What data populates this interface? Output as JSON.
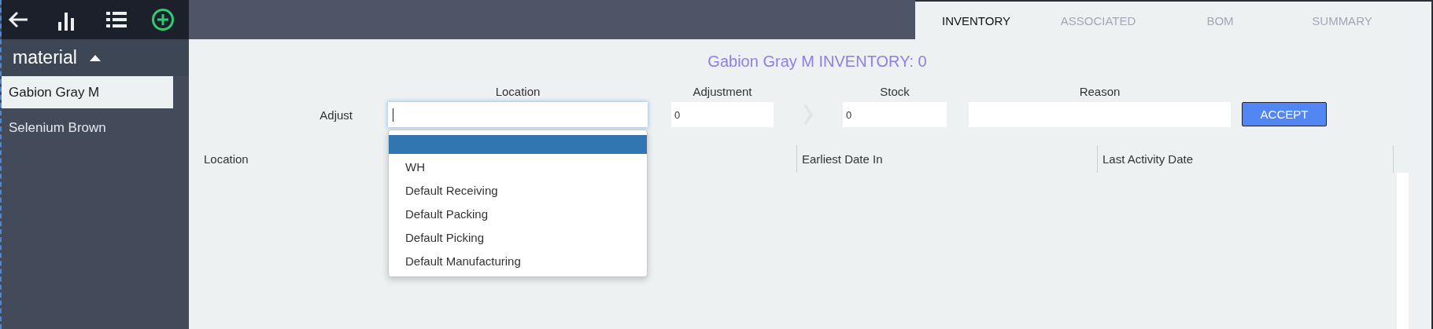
{
  "sidebar": {
    "header": "material",
    "expanded": true,
    "items": [
      {
        "label": "Gabion Gray M",
        "selected": true
      },
      {
        "label": "Selenium Brown",
        "selected": false
      }
    ]
  },
  "tabs": [
    {
      "label": "INVENTORY",
      "selected": true
    },
    {
      "label": "ASSOCIATED",
      "selected": false
    },
    {
      "label": "BOM",
      "selected": false
    },
    {
      "label": "SUMMARY",
      "selected": false
    }
  ],
  "title": "Gabion Gray M INVENTORY: 0",
  "adjust_form": {
    "label": "Adjust",
    "location": {
      "label": "Location",
      "focused": true
    },
    "adjustment": {
      "label": "Adjustment",
      "value": "0"
    },
    "stock": {
      "label": "Stock",
      "value": "0"
    },
    "reason": {
      "label": "Reason"
    },
    "button": "ACCEPT"
  },
  "location_dropdown": {
    "blank_option_selected": true,
    "options": [
      {
        "label": "WH",
        "selected": false
      },
      {
        "label": "Default Receiving",
        "selected": false
      },
      {
        "label": "Default Packing",
        "selected": false
      },
      {
        "label": "Default Picking",
        "selected": false
      },
      {
        "label": "Default Manufacturing",
        "selected": false
      }
    ]
  },
  "table": {
    "columns": [
      "Location",
      "Earliest Date In",
      "Last Activity Date"
    ]
  }
}
